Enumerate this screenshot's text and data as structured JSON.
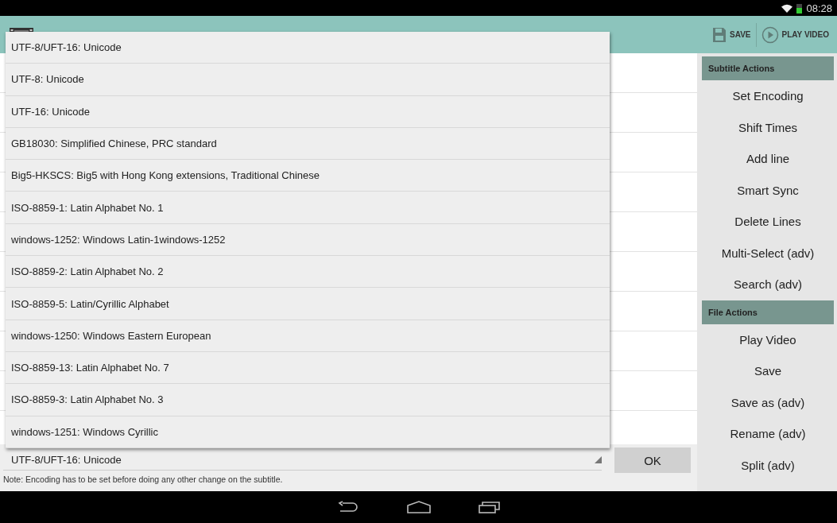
{
  "status_bar": {
    "time": "08:28"
  },
  "action_bar": {
    "actions": [
      {
        "label": "SAVE",
        "kind": "save"
      },
      {
        "label": "PLAY VIDEO",
        "kind": "play"
      }
    ]
  },
  "encoding_dropdown": {
    "options": [
      "UTF-8/UFT-16: Unicode",
      "UTF-8: Unicode",
      "UTF-16: Unicode",
      "GB18030: Simplified Chinese, PRC standard",
      "Big5-HKSCS: Big5 with Hong Kong extensions, Traditional Chinese",
      "ISO-8859-1: Latin Alphabet No. 1",
      "windows-1252: Windows Latin-1windows-1252",
      "ISO-8859-2: Latin Alphabet No. 2",
      "ISO-8859-5: Latin/Cyrillic Alphabet",
      "windows-1250: Windows Eastern European",
      "ISO-8859-13: Latin Alphabet No. 7",
      "ISO-8859-3: Latin Alphabet No. 3",
      "windows-1251: Windows Cyrillic"
    ]
  },
  "encoding_spinner": {
    "value": "UTF-8/UFT-16: Unicode"
  },
  "ok_button": "OK",
  "note": "Note: Encoding has to be set before doing any other change on the subtitle.",
  "sidebar": {
    "sections": [
      {
        "title": "Subtitle Actions",
        "items": [
          "Set Encoding",
          "Shift Times",
          "Add line",
          "Smart Sync",
          "Delete Lines",
          "Multi-Select (adv)",
          "Search (adv)"
        ]
      },
      {
        "title": "File Actions",
        "items": [
          "Play Video",
          "Save",
          "Save as (adv)",
          "Rename (adv)",
          "Split (adv)"
        ]
      }
    ]
  }
}
